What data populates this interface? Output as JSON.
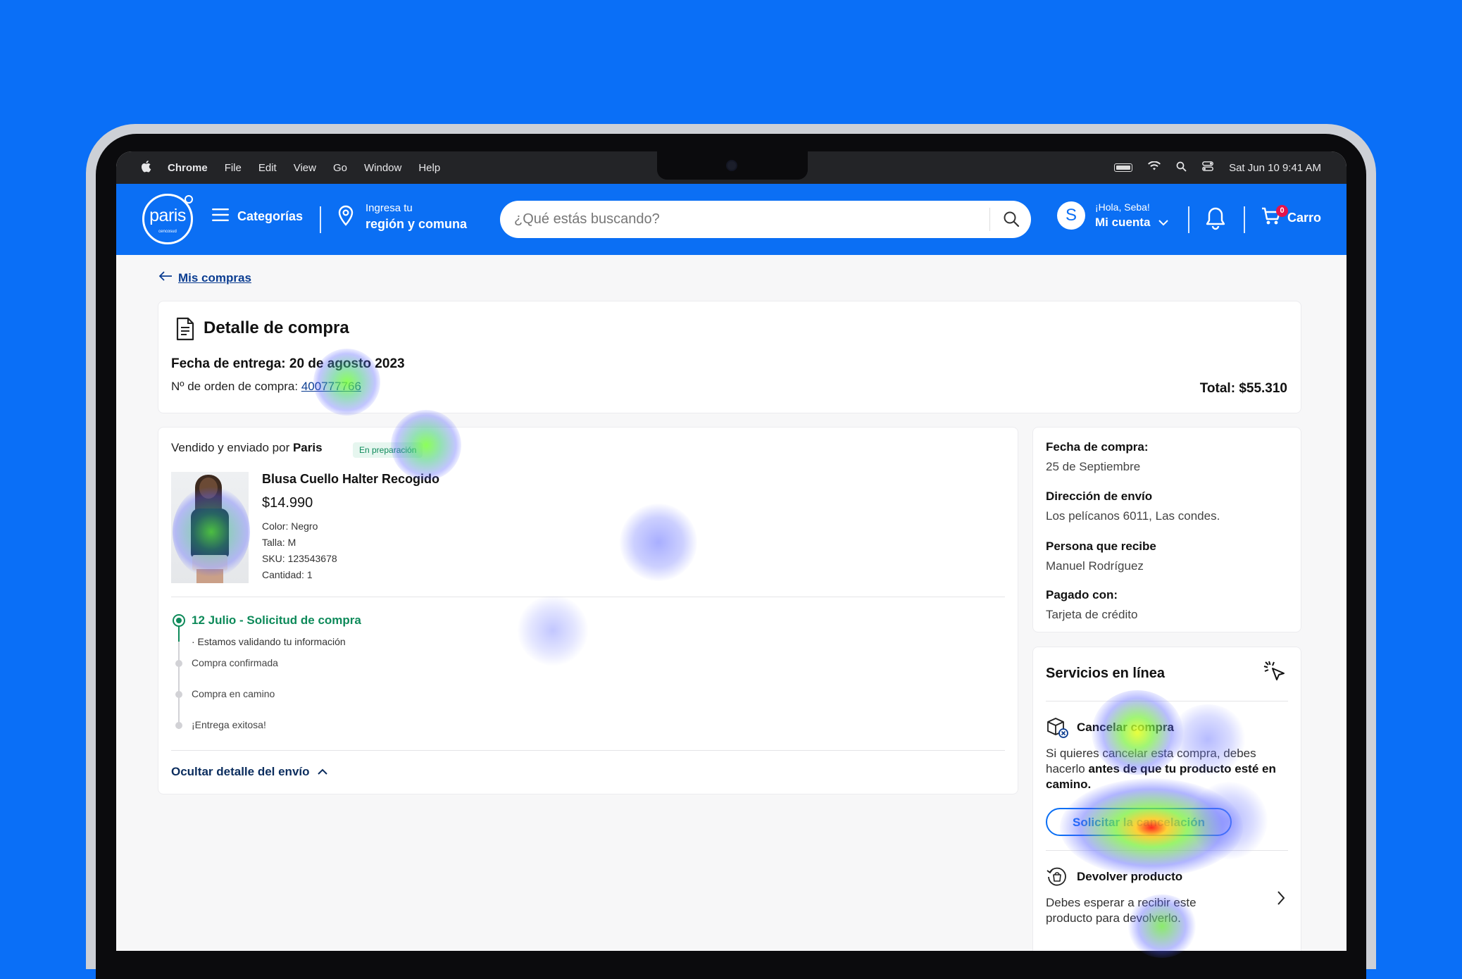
{
  "menubar": {
    "app": "Chrome",
    "items": [
      "File",
      "Edit",
      "View",
      "Go",
      "Window",
      "Help"
    ],
    "datetime": "Sat Jun 10  9:41 AM"
  },
  "header": {
    "logo_word": "paris",
    "logo_sub": "cencosud",
    "categories_label": "Categorías",
    "location_line1": "Ingresa tu",
    "location_line2": "región y comuna",
    "search_placeholder": "¿Qué estás buscando?",
    "avatar_letter": "S",
    "greeting": "¡Hola, Seba!",
    "account_label": "Mi cuenta",
    "cart_count": "0",
    "cart_label": "Carro"
  },
  "back_link": "Mis compras",
  "detail": {
    "title": "Detalle de compra",
    "delivery_date": "Fecha de entrega: 20 de agosto 2023",
    "order_label": "Nº de orden de compra: ",
    "order_number": "400777766",
    "total": "Total: $55.310"
  },
  "shipment": {
    "seller_prefix": "Vendido y enviado por ",
    "seller_name": "Paris",
    "status_badge": "En preparación",
    "product": {
      "name": "Blusa Cuello Halter Recogido",
      "price": "$14.990",
      "color": "Color: Negro",
      "size": "Talla: M",
      "sku": "SKU: 123543678",
      "quantity": "Cantidad: 1"
    },
    "timeline": {
      "active_step": "12 Julio - Solicitud de compra",
      "active_sub": "· Estamos validando tu información",
      "steps": [
        "Compra confirmada",
        "Compra en camino",
        "¡Entrega exitosa!"
      ]
    },
    "toggle_label": "Ocultar detalle del envío"
  },
  "summary": {
    "purchase_date_label": "Fecha de compra:",
    "purchase_date": "25 de Septiembre",
    "address_label": "Dirección de envío",
    "address": "Los pelícanos 6011, Las condes.",
    "recipient_label": "Persona que recibe",
    "recipient": "Manuel Rodríguez",
    "payment_label": "Pagado con:",
    "payment": "Tarjeta de crédito"
  },
  "services": {
    "title": "Servicios en línea",
    "cancel": {
      "name": "Cancelar compra",
      "desc_prefix": "Si quieres cancelar esta compra, debes hacerlo ",
      "desc_bold": "antes de que tu producto esté en camino.",
      "button": "Solicitar la cancelación"
    },
    "return": {
      "name": "Devolver producto",
      "desc": "Debes esperar a recibir este producto para devolverlo."
    }
  },
  "colors": {
    "background": "#0a6ff7",
    "brand_blue": "#0b6ff4",
    "success_green": "#0e8a5a",
    "cart_badge": "#e5134c"
  }
}
